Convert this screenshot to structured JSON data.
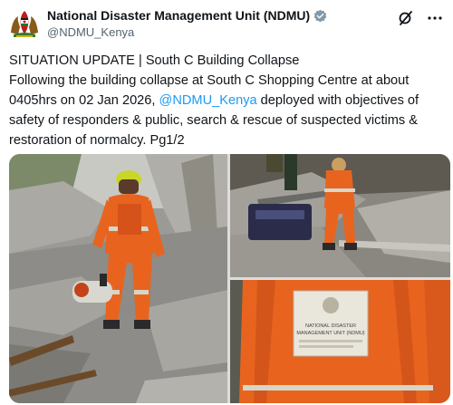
{
  "account": {
    "display_name": "National Disaster Management Unit (NDMU)",
    "handle": "@NDMU_Kenya",
    "avatar_icon": "kenya-coat-of-arms-icon",
    "verified_icon": "verified-badge-icon"
  },
  "top_actions": [
    {
      "icon": "grok-icon"
    },
    {
      "icon": "more-options-icon"
    }
  ],
  "tweet": {
    "line1": "SITUATION UPDATE | South C Building Collapse",
    "text_before_mention": "Following the building collapse at South C Shopping Centre at about 0405hrs on 02 Jan 2026, ",
    "mention": "@NDMU_Kenya",
    "text_after_mention": " deployed with objectives of safety of responders & public, search & rescue of suspected victims & restoration of normalcy. Pg1/2"
  },
  "media": {
    "photos": [
      {
        "subject": "rescuer-in-orange-suit-with-saw"
      },
      {
        "subject": "rescuers-on-rubble"
      },
      {
        "subject": "rescuer-back-with-ndmu-patch"
      }
    ],
    "patch_text": "NATIONAL DISASTER MANAGEMENT UNIT (NDMU)"
  },
  "colors": {
    "mention": "#1d9bf0",
    "orange_suit": "#e8641e",
    "verified": "#829aab"
  }
}
